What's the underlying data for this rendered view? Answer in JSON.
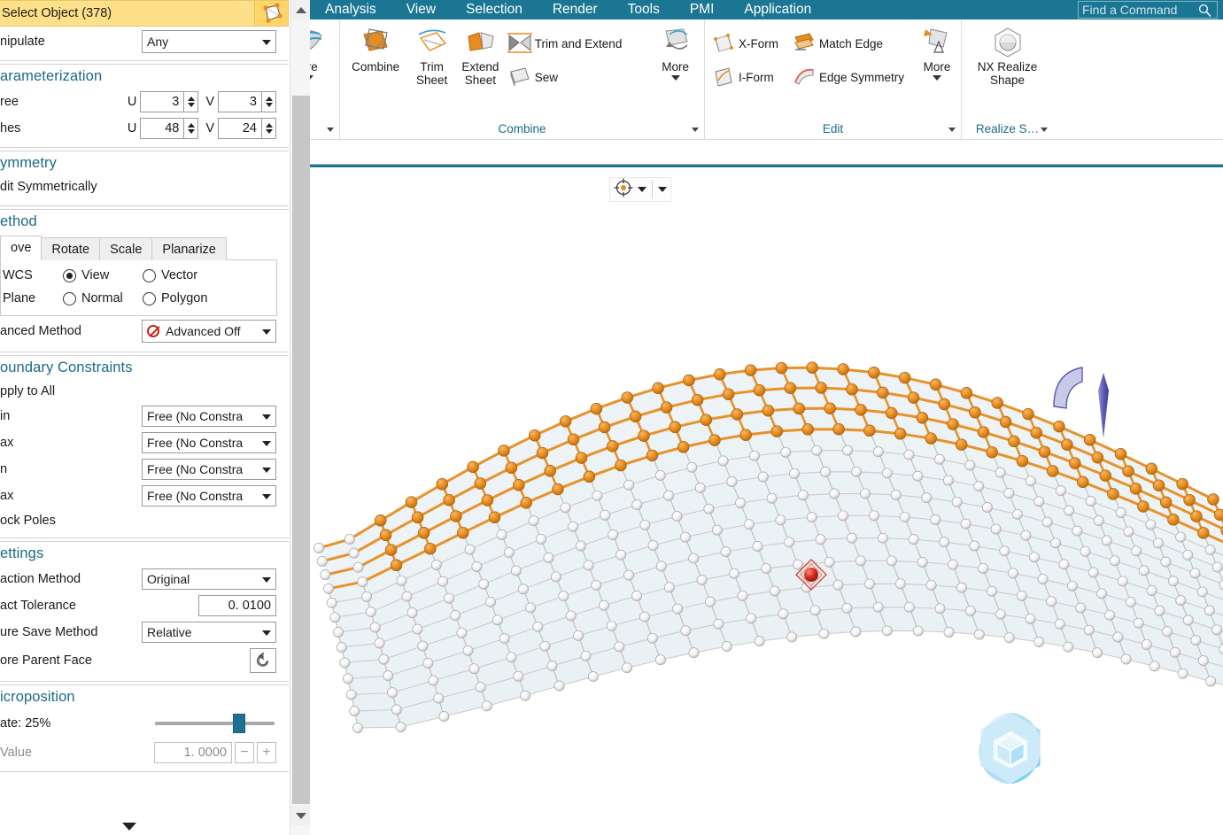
{
  "ribbon": {
    "tabs": [
      "Analysis",
      "View",
      "Selection",
      "Render",
      "Tools",
      "PMI",
      "Application"
    ],
    "find_command_placeholder": "Find a Command",
    "groups": [
      {
        "name": "surface-more",
        "label": "",
        "buttons": [
          {
            "label": "ore",
            "icon": "surface-icon"
          }
        ]
      },
      {
        "name": "combine",
        "label": "Combine",
        "buttons": [
          {
            "label": "Combine",
            "icon": "combine-icon"
          },
          {
            "label": "Trim Sheet",
            "icon": "trim-sheet-icon"
          },
          {
            "label": "Extend Sheet",
            "icon": "extend-sheet-icon"
          },
          {
            "label": "Trim and Extend",
            "icon": "trim-extend-icon"
          },
          {
            "label": "Sew",
            "icon": "sew-icon"
          },
          {
            "label": "More",
            "icon": "more-combine-icon"
          }
        ]
      },
      {
        "name": "edit",
        "label": "Edit",
        "buttons": [
          {
            "label": "X-Form",
            "icon": "x-form-icon"
          },
          {
            "label": "I-Form",
            "icon": "i-form-icon"
          },
          {
            "label": "Match Edge",
            "icon": "match-edge-icon"
          },
          {
            "label": "Edge Symmetry",
            "icon": "edge-symmetry-icon"
          },
          {
            "label": "More",
            "icon": "more-edit-icon"
          }
        ]
      },
      {
        "name": "realize-shape",
        "label": "Realize S…",
        "buttons": [
          {
            "label": "NX Realize Shape",
            "icon": "realize-shape-icon"
          }
        ]
      }
    ]
  },
  "dialog": {
    "select_object": {
      "label": "Select Object (378)",
      "icon": "select-poles-icon"
    },
    "manipulate": {
      "label": "nipulate",
      "value": "Any"
    },
    "parameterization": {
      "title": "arameterization",
      "degree": {
        "label": "ree",
        "u_prefix": "U",
        "u": "3",
        "v_prefix": "V",
        "v": "3"
      },
      "patches": {
        "label": "hes",
        "u_prefix": "U",
        "u": "48",
        "v_prefix": "V",
        "v": "24"
      }
    },
    "symmetry": {
      "title": "ymmetry",
      "edit_symmetrically": "dit Symmetrically"
    },
    "method": {
      "title": "ethod",
      "tabs": [
        "ove",
        "Rotate",
        "Scale",
        "Planarize"
      ],
      "active_tab": "ove",
      "orientation_rows": [
        {
          "label": "WCS",
          "options": [
            {
              "label": "View",
              "selected": true
            },
            {
              "label": "Vector",
              "selected": false
            }
          ]
        },
        {
          "label": "Plane",
          "options": [
            {
              "label": "Normal",
              "selected": false
            },
            {
              "label": "Polygon",
              "selected": false
            }
          ]
        }
      ],
      "advanced": {
        "label": "anced Method",
        "value": "Advanced Off",
        "icon": "no-entry-icon"
      }
    },
    "boundary_constraints": {
      "title": "oundary Constraints",
      "apply_to_all": "pply to All",
      "constraints": [
        {
          "label": "in",
          "value": "Free (No Constra"
        },
        {
          "label": "ax",
          "value": "Free (No Constra"
        },
        {
          "label": "n",
          "value": "Free (No Constra"
        },
        {
          "label": "ax",
          "value": "Free (No Constra"
        }
      ],
      "lock_poles": "ock Poles"
    },
    "settings": {
      "title": "ettings",
      "extraction_method": {
        "label": "action Method",
        "value": "Original"
      },
      "exact_tolerance": {
        "label": "act Tolerance",
        "value": "0. 0100"
      },
      "feature_save_method": {
        "label": "ure Save Method",
        "value": "Relative"
      },
      "restore_parent_face": {
        "label": "ore Parent Face",
        "icon": "reset-icon"
      }
    },
    "microposition": {
      "title": "icroposition",
      "rate": {
        "label": "ate: 25%",
        "slider_percent": 70
      },
      "value": {
        "label": "Value",
        "value": "1. 0000",
        "minus": "−",
        "plus": "+"
      }
    }
  },
  "viewport": {
    "toolbar": {
      "icon": "move-origin-icon",
      "caret": "dropdown-caret"
    },
    "logo": "nx-logo",
    "model": {
      "description": "NURBS surface control cage",
      "selected_pole_color": "#E88C1E",
      "unselected_pole_color": "#FFFFFF",
      "surface_color": "#C9DCE4",
      "manipulator_arrow_color": "#6A6ABF",
      "origin_pole_color": "#CC2020"
    }
  }
}
